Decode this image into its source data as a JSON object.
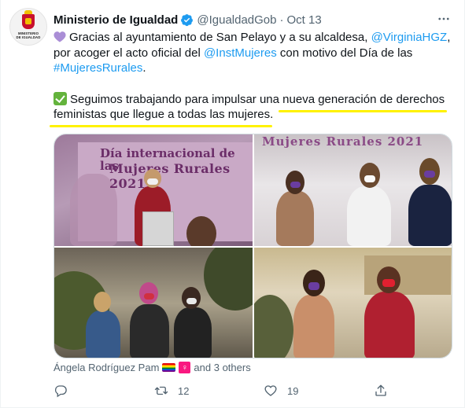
{
  "tweet": {
    "author_name": "Ministerio de Igualdad",
    "handle": "@IgualdadGob",
    "separator": "·",
    "date": "Oct 13",
    "avatar_text": "MINISTERIO\nDE IGUALDAD",
    "lines": {
      "l1_a": "Gracias al ayuntamiento de San Pelayo y a su alcaldesa, ",
      "l1_link": "@VirginiaHGZ",
      "l1_b": ",",
      "l2_a": "por acoger el acto oficial del ",
      "l2_link": "@InstMujeres",
      "l2_b": " con motivo del Día de las",
      "l3_link": "#MujeresRurales",
      "l3_b": ".",
      "l5": "Seguimos trabajando para impulsar una nueva generación de derechos",
      "l6": "feministas que llegue a todas las mujeres."
    }
  },
  "media": {
    "photo1_banner_title": "Día internacional de las",
    "photo1_banner_sub": "Mujeres Rurales 2021",
    "photo2_banner": "Mujeres Rurales 2021"
  },
  "likers": {
    "name": "Ángela Rodríguez Pam",
    "venus_symbol": "♀",
    "others": "and 3 others"
  },
  "actions": {
    "reply_count": "",
    "retweet_count": "12",
    "like_count": "19"
  },
  "icons": [
    "verified-badge-icon",
    "more-icon",
    "purple-heart-icon",
    "check-mark-icon",
    "rainbow-flag-icon",
    "venus-icon",
    "reply-icon",
    "retweet-icon",
    "like-icon",
    "share-icon"
  ],
  "colors": {
    "link": "#1d9bf0",
    "verified": "#1d9bf0",
    "highlight": "#fff200",
    "secondary_text": "#536471"
  }
}
